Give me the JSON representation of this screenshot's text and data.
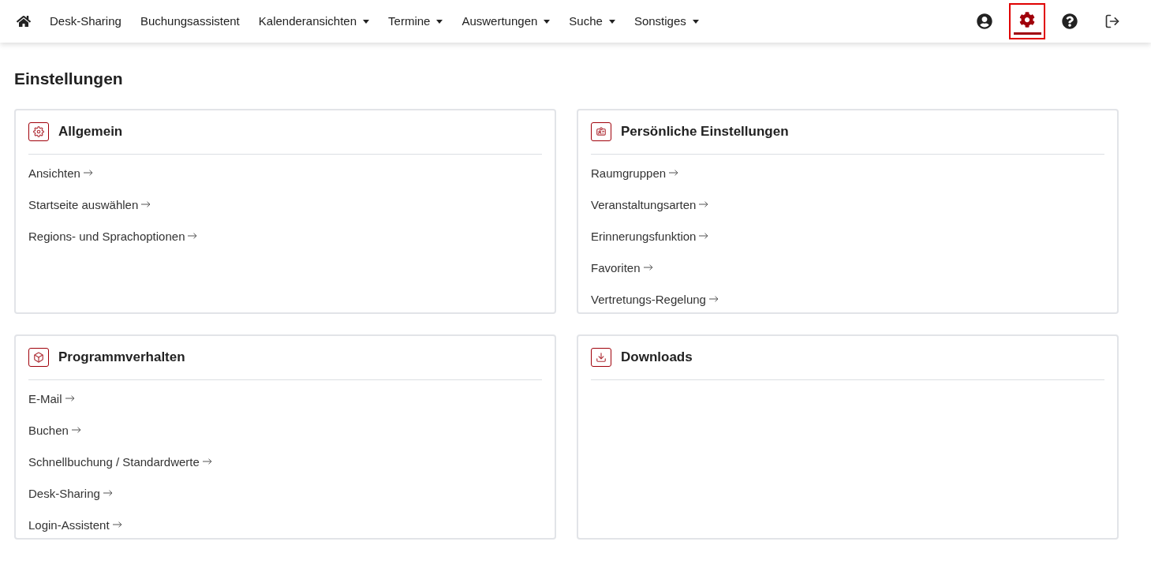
{
  "nav": {
    "items": [
      {
        "label": "Desk-Sharing",
        "dropdown": false
      },
      {
        "label": "Buchungsassistent",
        "dropdown": false
      },
      {
        "label": "Kalenderansichten",
        "dropdown": true
      },
      {
        "label": "Termine",
        "dropdown": true
      },
      {
        "label": "Auswertungen",
        "dropdown": true
      },
      {
        "label": "Suche",
        "dropdown": true
      },
      {
        "label": "Sonstiges",
        "dropdown": true
      }
    ],
    "actions": [
      {
        "kind": "user",
        "selected": false
      },
      {
        "kind": "settings",
        "selected": true
      },
      {
        "kind": "help",
        "selected": false
      },
      {
        "kind": "logout",
        "selected": false
      }
    ]
  },
  "page_title": "Einstellungen",
  "cards": [
    {
      "kind": "gear",
      "title": "Allgemein",
      "links": [
        "Ansichten",
        "Startseite auswählen",
        "Regions- und Sprachoptionen"
      ]
    },
    {
      "kind": "id-card",
      "title": "Persönliche Einstellungen",
      "links": [
        "Raumgruppen",
        "Veranstaltungsarten",
        "Erinnerungsfunktion",
        "Favoriten",
        "Vertretungs-Regelung"
      ]
    },
    {
      "kind": "cube",
      "title": "Programmverhalten",
      "links": [
        "E-Mail",
        "Buchen",
        "Schnellbuchung / Standardwerte",
        "Desk-Sharing",
        "Login-Assistent"
      ]
    },
    {
      "kind": "download",
      "title": "Downloads"
    }
  ]
}
